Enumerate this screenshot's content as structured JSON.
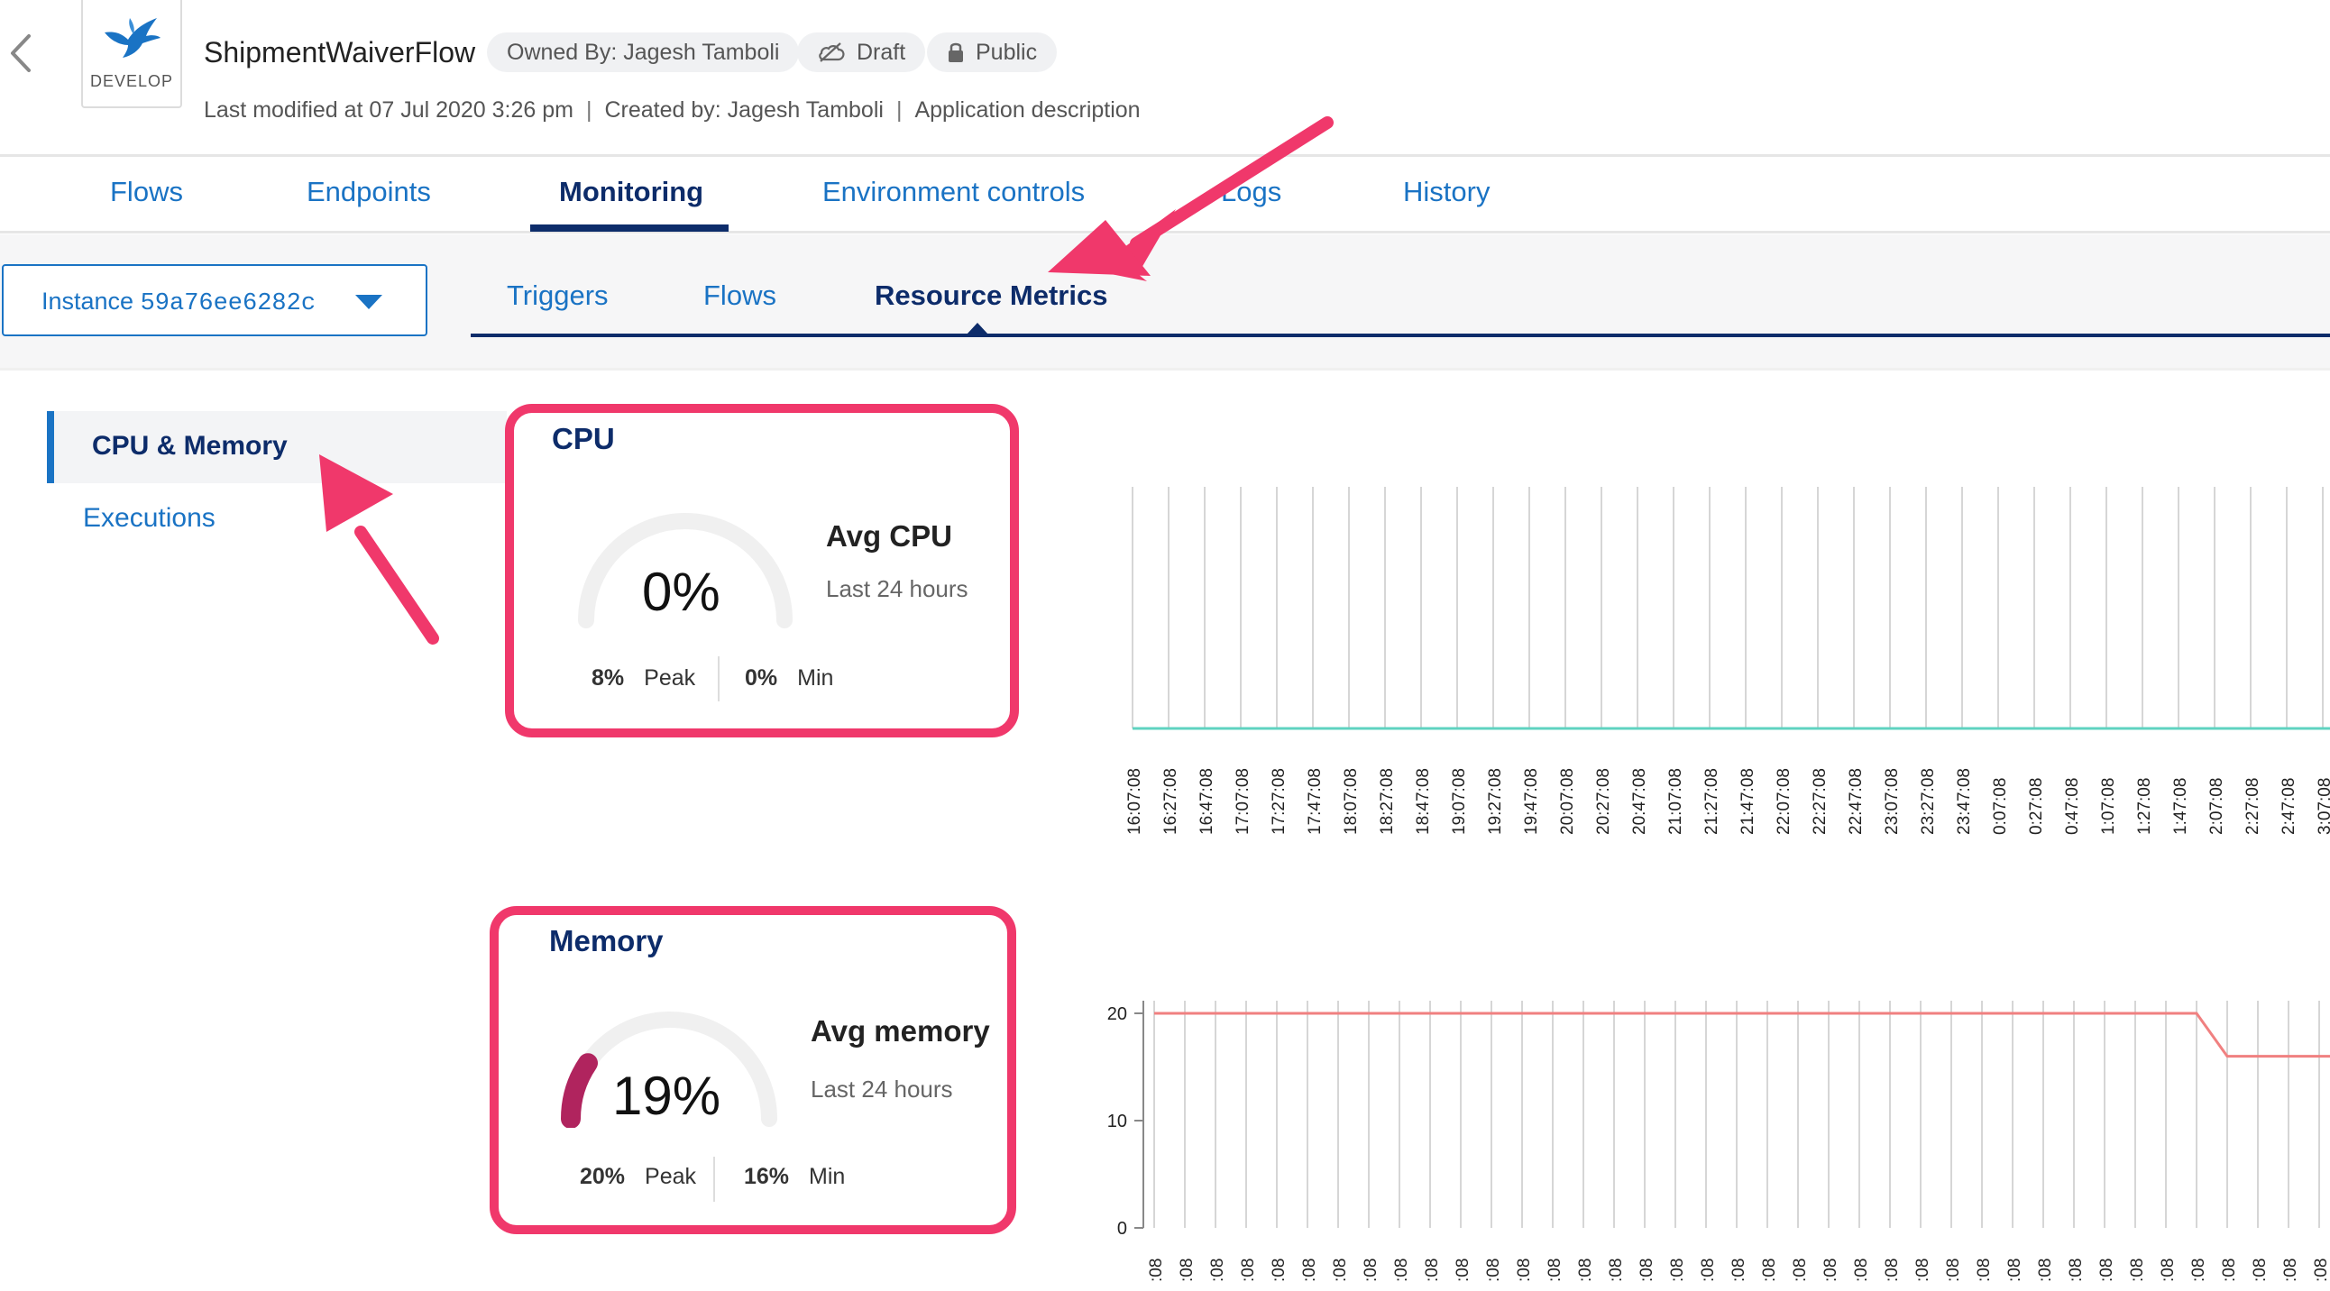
{
  "header": {
    "env_label": "DEVELOP",
    "app_title": "ShipmentWaiverFlow",
    "owner_chip": "Owned By: Jagesh Tamboli",
    "draft_chip": "Draft",
    "public_chip": "Public",
    "last_modified": "Last modified at 07 Jul 2020 3:26 pm",
    "created_by": "Created by: Jagesh Tamboli",
    "description": "Application description",
    "separator": "|"
  },
  "main_tabs": [
    {
      "label": "Flows"
    },
    {
      "label": "Endpoints"
    },
    {
      "label": "Monitoring",
      "active": true
    },
    {
      "label": "Environment controls"
    },
    {
      "label": "Logs"
    },
    {
      "label": "History"
    }
  ],
  "instance": {
    "prefix": "Instance",
    "id": "59a76ee6282c"
  },
  "sub_tabs": [
    {
      "label": "Triggers"
    },
    {
      "label": "Flows"
    },
    {
      "label": "Resource Metrics",
      "active": true
    }
  ],
  "side_nav": {
    "active": "CPU & Memory",
    "other": "Executions"
  },
  "cpu": {
    "title": "CPU",
    "value": "0%",
    "value_fraction": 0,
    "avg_label": "Avg CPU",
    "period": "Last 24 hours",
    "peak": "8%",
    "peak_label": "Peak",
    "min": "0%",
    "min_label": "Min"
  },
  "memory": {
    "title": "Memory",
    "value": "19%",
    "value_fraction": 0.19,
    "avg_label": "Avg memory",
    "period": "Last 24 hours",
    "peak": "20%",
    "peak_label": "Peak",
    "min": "16%",
    "min_label": "Min"
  },
  "colors": {
    "accent": "#1a73c4",
    "navy": "#0d2c6a",
    "annotation": "#f0386b",
    "cpu_line": "#5fd3c0",
    "mem_line": "#f08080",
    "gauge_track": "#f0f0f0",
    "gauge_fill": "#b0245e"
  },
  "chart_data": [
    {
      "type": "line",
      "title": "CPU",
      "x": [
        "16:07:08",
        "16:27:08",
        "16:47:08",
        "17:07:08",
        "17:27:08",
        "17:47:08",
        "18:07:08",
        "18:27:08",
        "18:47:08",
        "19:07:08",
        "19:27:08",
        "19:47:08",
        "20:07:08",
        "20:27:08",
        "20:47:08",
        "21:07:08",
        "21:27:08",
        "21:47:08",
        "22:07:08",
        "22:27:08",
        "22:47:08",
        "23:07:08",
        "23:27:08",
        "23:47:08",
        "0:07:08",
        "0:27:08",
        "0:47:08",
        "1:07:08",
        "1:27:08",
        "1:47:08",
        "2:07:08",
        "2:27:08",
        "2:47:08",
        "3:07:08"
      ],
      "series": [
        {
          "values": [
            0,
            0,
            0,
            0,
            0,
            0,
            0,
            0,
            0,
            0,
            0,
            0,
            0,
            0,
            0,
            0,
            0,
            0,
            0,
            0,
            0,
            0,
            0,
            0,
            0,
            0,
            0,
            0,
            0,
            0,
            0,
            0,
            0,
            0
          ]
        }
      ],
      "grid": true
    },
    {
      "type": "line",
      "title": "Memory",
      "yticks": [
        0,
        10,
        20
      ],
      "ylim": [
        0,
        20
      ],
      "x_count": 40,
      "x_tick_fragment": ":08",
      "series": [
        {
          "values": [
            20,
            20,
            20,
            20,
            20,
            20,
            20,
            20,
            20,
            20,
            20,
            20,
            20,
            20,
            20,
            20,
            20,
            20,
            20,
            20,
            20,
            20,
            20,
            20,
            20,
            20,
            20,
            20,
            20,
            20,
            20,
            20,
            20,
            20,
            20,
            16,
            16,
            16,
            16,
            16
          ]
        }
      ],
      "grid": true
    }
  ]
}
